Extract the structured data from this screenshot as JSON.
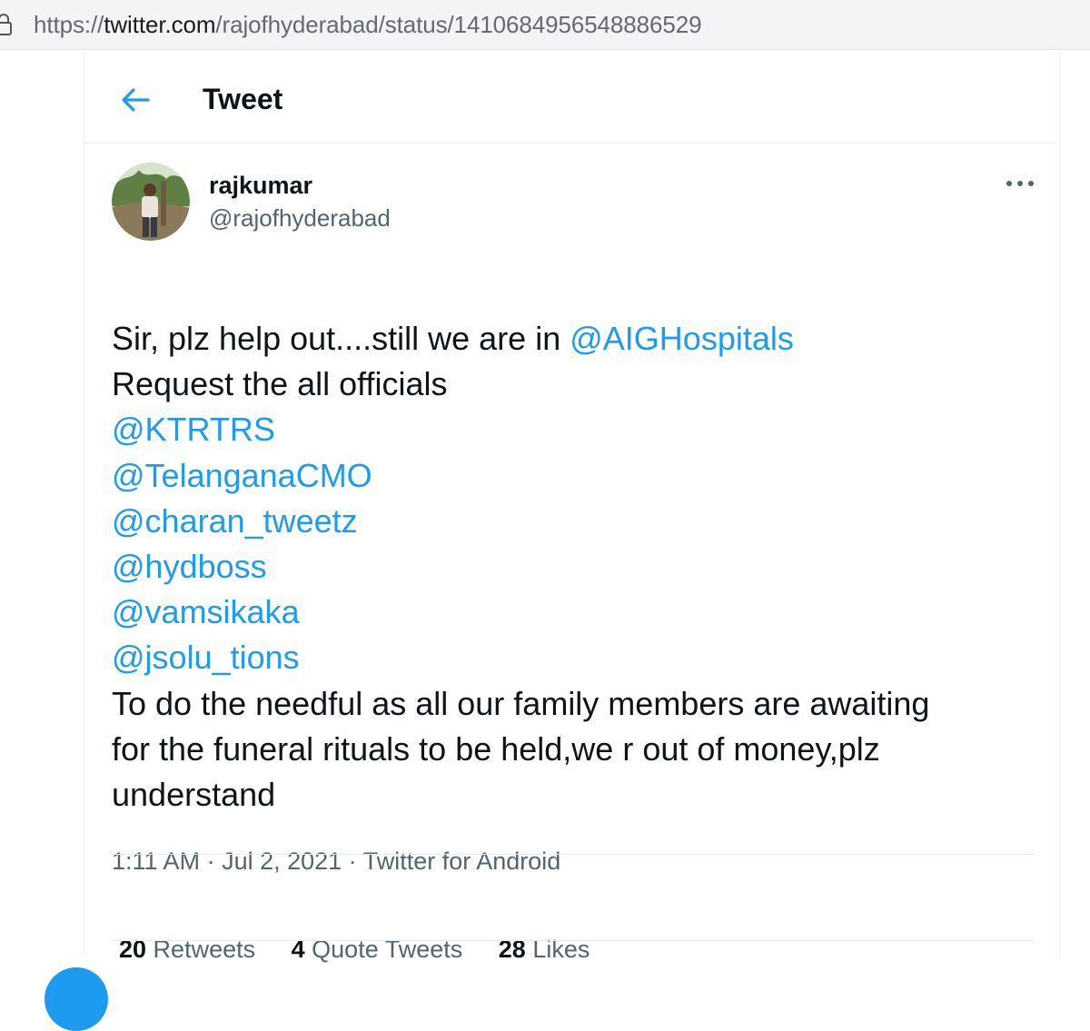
{
  "browser": {
    "url_scheme": "https://",
    "url_host": "twitter.com",
    "url_path": "/rajofhyderabad/status/1410684956548886529"
  },
  "header": {
    "title": "Tweet",
    "back_icon": "arrow-left-icon"
  },
  "tweet": {
    "author_name": "rajkumar",
    "author_handle": "@rajofhyderabad",
    "more_icon": "more-horizontal-icon",
    "line1_text": "Sir, plz help out....still we are in ",
    "line1_mention": "@AIGHospitals",
    "line2_text": "Request the all officials",
    "mentions": [
      "@KTRTRS",
      "@TelanganaCMO",
      "@charan_tweetz",
      "@hydboss",
      "@vamsikaka",
      "@jsolu_tions"
    ],
    "closing_lines": [
      "To do the needful as all our family members are awaiting",
      "for the funeral rituals to be held,we r out of money,plz",
      "understand"
    ],
    "time": "1:11 AM",
    "separator": " · ",
    "date": "Jul 2, 2021",
    "source": "Twitter for Android"
  },
  "stats": {
    "retweets_count": "20",
    "retweets_label": " Retweets",
    "quotes_count": "4",
    "quotes_label": " Quote Tweets",
    "likes_count": "28",
    "likes_label": " Likes"
  },
  "colors": {
    "accent": "#1d9bf0",
    "text_primary": "#0f1419",
    "text_secondary": "#536471"
  }
}
